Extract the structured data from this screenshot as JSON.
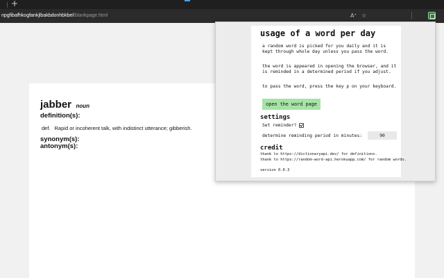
{
  "browser": {
    "new_tab_glyph": "+",
    "url_host": "npgfibafhkogfankjlbakbdonhbkbel",
    "url_path": "/blankpage.html",
    "toolbar_icons": [
      "read-aloud-icon",
      "favorites-star-icon",
      "extension-icon"
    ],
    "read_aloud_glyph": "Aᐩ",
    "favorites_glyph": "☆"
  },
  "page": {
    "word": "jabber",
    "part_of_speech": "noun",
    "definitions_label": "definition(s):",
    "definition_prefix": "def.",
    "definition_text": "Rapid or incoherent talk, with indistinct utterance; gibberish.",
    "synonyms_label": "synonym(s):",
    "antonyms_label": "antonym(s):"
  },
  "popup": {
    "title": "usage of a word per day",
    "desc1": "a random word is picked for you daily and it is kept through whole day unless you pass the word.",
    "desc2": "the word is appeared in opening the browser, and it is reminded in a determined period if you adjust.",
    "desc3": "to pass the word, press the key p on your keyboard.",
    "open_button": "open the word page",
    "settings_heading": "settings",
    "reminder_label": "Set reminder?",
    "reminder_checked": true,
    "period_label": "determine reminding period in minutes:",
    "period_value": "90",
    "credit_heading": "credit",
    "credit_line1": "thank to https://dictionaryapi.dev/ for definitions.",
    "credit_line2": "thank to https://random-word-api.herokuapp.com/ for random words.",
    "version": "version 0.0.3"
  },
  "colors": {
    "button_green": "#a6e3a6",
    "chrome_dark": "#2b2b2b"
  }
}
